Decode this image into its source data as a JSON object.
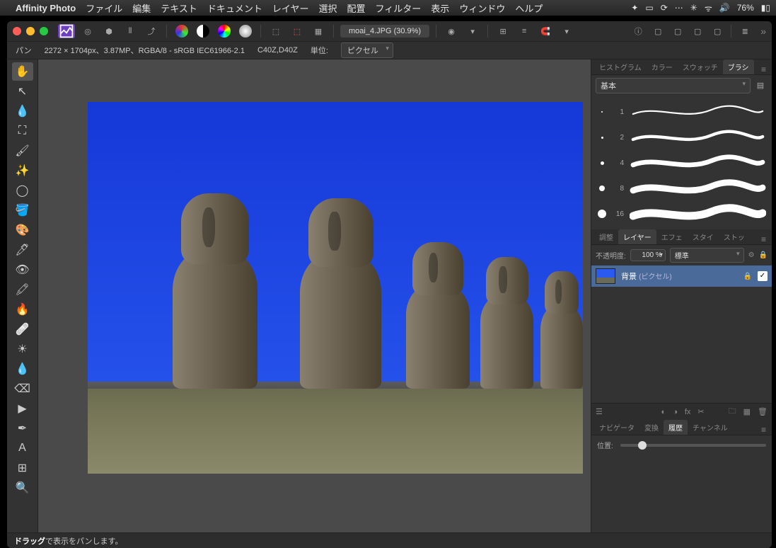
{
  "mac_menu": {
    "app_name": "Affinity Photo",
    "items": [
      "ファイル",
      "編集",
      "テキスト",
      "ドキュメント",
      "レイヤー",
      "選択",
      "配置",
      "フィルター",
      "表示",
      "ウィンドウ",
      "ヘルプ"
    ],
    "battery": "76%"
  },
  "toolbar": {
    "doc_title": "moai_4.JPG (30.9%)"
  },
  "infobar": {
    "tool_name": "パン",
    "dimensions": "2272 × 1704px、3.87MP、RGBA/8 - sRGB IEC61966-2.1",
    "camera": "C40Z,D40Z",
    "unit_label": "単位:",
    "unit_value": "ピクセル"
  },
  "brush_panel": {
    "tabs": [
      "ヒストグラム",
      "カラー",
      "スウォッチ",
      "ブラシ"
    ],
    "active_tab": 3,
    "category": "基本",
    "brushes": [
      {
        "size": "1"
      },
      {
        "size": "2"
      },
      {
        "size": "4"
      },
      {
        "size": "8"
      },
      {
        "size": "16"
      }
    ]
  },
  "layer_panel": {
    "tabs": [
      "調整",
      "レイヤー",
      "エフェ",
      "スタイ",
      "ストッ"
    ],
    "active_tab": 1,
    "opacity_label": "不透明度:",
    "opacity_value": "100 %",
    "blend_mode": "標準",
    "layers": [
      {
        "name": "背景",
        "type": "(ピクセル)",
        "locked": true,
        "visible": true
      }
    ]
  },
  "nav_panel": {
    "tabs": [
      "ナビゲータ",
      "変換",
      "履歴",
      "チャンネル"
    ],
    "active_tab": 2,
    "position_label": "位置:"
  },
  "statusbar": {
    "bold": "ドラッグ",
    "rest": "で表示をパンします。"
  },
  "tools": [
    {
      "name": "hand-tool",
      "glyph": "✋",
      "active": true
    },
    {
      "name": "move-tool",
      "glyph": "↖"
    },
    {
      "name": "color-picker-tool",
      "glyph": "💧"
    },
    {
      "name": "crop-tool",
      "glyph": "⛶"
    },
    {
      "name": "brush-tool",
      "glyph": "🖌"
    },
    {
      "name": "wand-tool",
      "glyph": "✨"
    },
    {
      "name": "marquee-tool",
      "glyph": "◯"
    },
    {
      "name": "flood-fill-tool",
      "glyph": "🪣"
    },
    {
      "name": "gradient-tool",
      "glyph": "🎨"
    },
    {
      "name": "pen-brush-tool",
      "glyph": "🖊"
    },
    {
      "name": "red-eye-tool",
      "glyph": "👁"
    },
    {
      "name": "stamp-tool",
      "glyph": "🖍"
    },
    {
      "name": "burn-tool",
      "glyph": "🔥"
    },
    {
      "name": "inpaint-tool",
      "glyph": "🩹"
    },
    {
      "name": "dodge-tool",
      "glyph": "☀"
    },
    {
      "name": "blur-tool",
      "glyph": "💧"
    },
    {
      "name": "erase-tool",
      "glyph": "⌫"
    },
    {
      "name": "node-tool",
      "glyph": "▶"
    },
    {
      "name": "pen-tool",
      "glyph": "✒"
    },
    {
      "name": "text-tool",
      "glyph": "A"
    },
    {
      "name": "mesh-tool",
      "glyph": "⊞"
    },
    {
      "name": "zoom-tool",
      "glyph": "🔍"
    }
  ]
}
